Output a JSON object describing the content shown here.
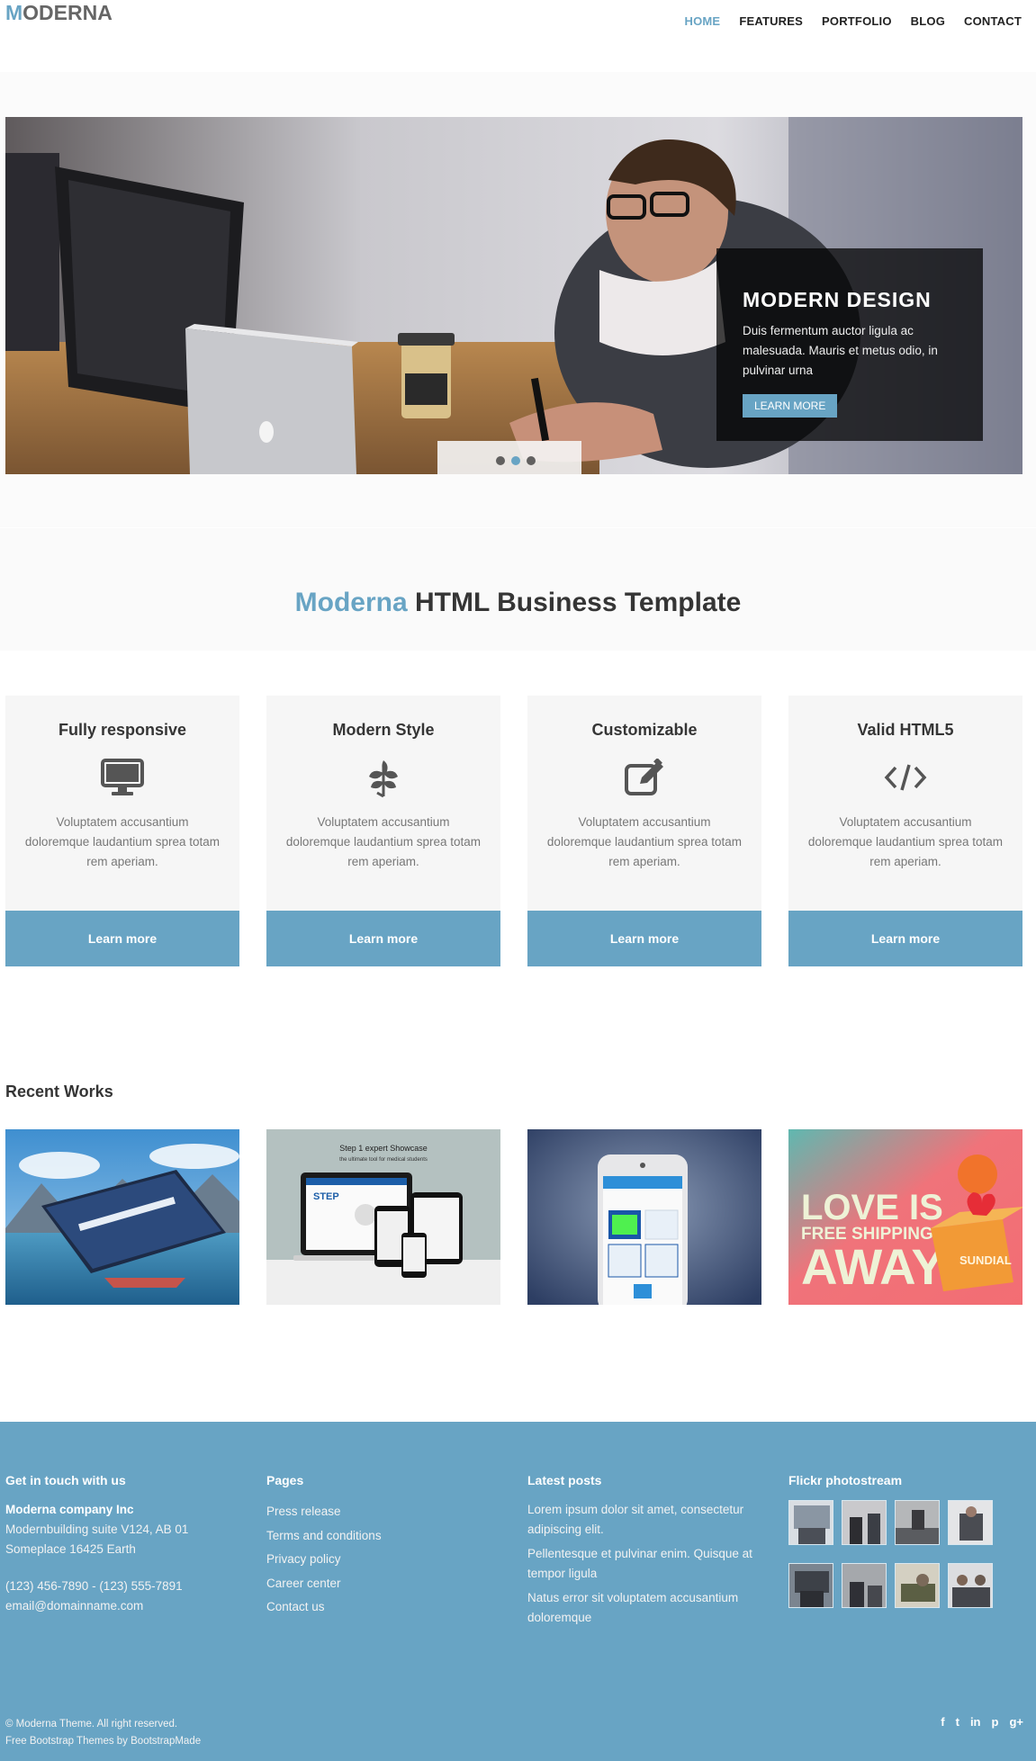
{
  "header": {
    "logo_first": "M",
    "logo_rest": "ODERNA",
    "nav": [
      {
        "label": "HOME",
        "active": true
      },
      {
        "label": "FEATURES"
      },
      {
        "label": "PORTFOLIO"
      },
      {
        "label": "BLOG"
      },
      {
        "label": "CONTACT"
      }
    ]
  },
  "slider": {
    "caption_title": "MODERN DESIGN",
    "caption_text": "Duis fermentum auctor ligula ac malesuada. Mauris et metus odio, in pulvinar urna",
    "caption_button": "LEARN MORE",
    "dots": 3,
    "active_dot": 1
  },
  "callout": {
    "accent": "Moderna",
    "rest": "HTML Business Template"
  },
  "features": [
    {
      "title": "Fully responsive",
      "icon": "desktop-icon",
      "text": "Voluptatem accusantium doloremque laudantium sprea totam rem aperiam.",
      "button": "Learn more"
    },
    {
      "title": "Modern Style",
      "icon": "leaf-icon",
      "text": "Voluptatem accusantium doloremque laudantium sprea totam rem aperiam.",
      "button": "Learn more"
    },
    {
      "title": "Customizable",
      "icon": "edit-icon",
      "text": "Voluptatem accusantium doloremque laudantium sprea totam rem aperiam.",
      "button": "Learn more"
    },
    {
      "title": "Valid HTML5",
      "icon": "code-icon",
      "text": "Voluptatem accusantium doloremque laudantium sprea totam rem aperiam.",
      "button": "Learn more"
    }
  ],
  "recent_works": {
    "title": "Recent Works",
    "items": [
      {
        "name": "work-mountain-lake"
      },
      {
        "name": "work-step-showcase",
        "caption_line1": "Step 1 expert Showcase",
        "caption_line2": "the ultimate tool for medical students",
        "logo": "STEP"
      },
      {
        "name": "work-phone-app"
      },
      {
        "name": "work-love-is-free-shipping",
        "text1": "LOVE IS",
        "text2": "FREE SHIPPING",
        "text3": "AWAY",
        "brand": "SUNDIAL"
      }
    ]
  },
  "footer": {
    "contact": {
      "title": "Get in touch with us",
      "company": "Moderna company Inc",
      "address1": "Modernbuilding suite V124, AB 01",
      "address2": "Someplace 16425 Earth",
      "phone": "(123) 456-7890 - (123) 555-7891",
      "email": "email@domainname.com"
    },
    "pages": {
      "title": "Pages",
      "links": [
        "Press release",
        "Terms and conditions",
        "Privacy policy",
        "Career center",
        "Contact us"
      ]
    },
    "posts": {
      "title": "Latest posts",
      "items": [
        "Lorem ipsum dolor sit amet, consectetur adipiscing elit.",
        "Pellentesque et pulvinar enim. Quisque at tempor ligula",
        "Natus error sit voluptatem accusantium doloremque"
      ]
    },
    "flickr": {
      "title": "Flickr photostream",
      "count": 8
    },
    "copyright": "© Moderna Theme. All right reserved.",
    "credit": "Free Bootstrap Themes by BootstrapMade",
    "social": [
      "f",
      "t",
      "in",
      "p",
      "g+"
    ]
  },
  "colors": {
    "accent": "#68a4c4",
    "dark": "#353535",
    "feature_bg": "#f6f6f6"
  }
}
